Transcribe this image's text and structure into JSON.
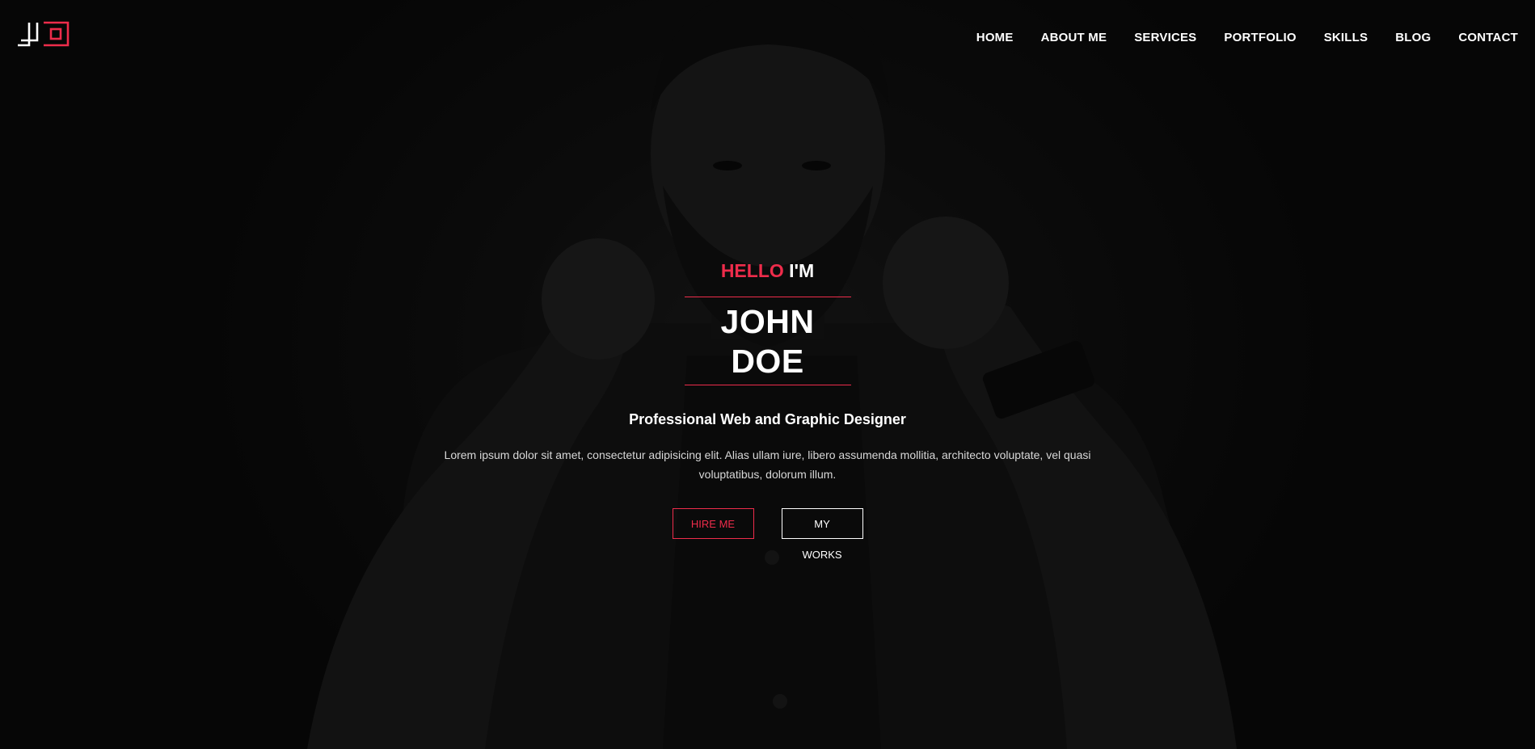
{
  "brand": {
    "logo_alt": "JD logo",
    "accent_color": "#ee2c4b"
  },
  "nav": {
    "items": [
      {
        "label": "HOME"
      },
      {
        "label": "ABOUT ME"
      },
      {
        "label": "SERVICES"
      },
      {
        "label": "PORTFOLIO"
      },
      {
        "label": "SKILLS"
      },
      {
        "label": "BLOG"
      },
      {
        "label": "CONTACT"
      }
    ]
  },
  "hero": {
    "greeting_accent": "HELLO",
    "greeting_rest": "I'M",
    "name": "JOHN DOE",
    "role": "Professional Web and Graphic Designer",
    "description": "Lorem ipsum dolor sit amet, consectetur adipisicing elit. Alias ullam iure, libero assumenda mollitia, architecto voluptate, vel quasi voluptatibus, dolorum illum.",
    "hire_button": "HIRE ME",
    "works_button": "MY WORKS",
    "background_image": "portrait-photo"
  }
}
